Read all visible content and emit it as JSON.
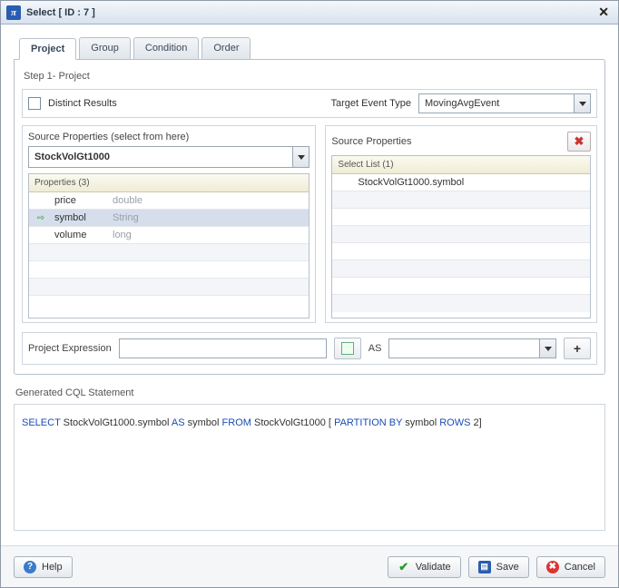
{
  "window": {
    "title": "Select [ ID : 7 ]"
  },
  "tabs": [
    {
      "label": "Project"
    },
    {
      "label": "Group"
    },
    {
      "label": "Condition"
    },
    {
      "label": "Order"
    }
  ],
  "step": "Step 1- Project",
  "distinct": {
    "label": "Distinct Results"
  },
  "target": {
    "label": "Target Event Type",
    "value": "MovingAvgEvent"
  },
  "sourceLeft": {
    "title": "Source Properties (select from here)",
    "selected": "StockVolGt1000",
    "gridTitle": "Properties (3)",
    "rows": [
      {
        "name": "price",
        "type": "double",
        "active": false
      },
      {
        "name": "symbol",
        "type": "String",
        "active": true
      },
      {
        "name": "volume",
        "type": "long",
        "active": false
      }
    ]
  },
  "sourceRight": {
    "title": "Source Properties",
    "gridTitle": "Select List (1)",
    "rows": [
      {
        "text": "StockVolGt1000.symbol"
      }
    ]
  },
  "projExpr": {
    "label": "Project Expression",
    "value": "",
    "asLabel": "AS",
    "asValue": ""
  },
  "generated": {
    "label": "Generated CQL Statement",
    "sql_parts": {
      "select": "SELECT",
      "col": " StockVolGt1000.symbol ",
      "as": "AS",
      "alias": " symbol ",
      "from": "FROM",
      "tbl": " StockVolGt1000  [ ",
      "pby": "PARTITION BY",
      "pcol": " symbol  ",
      "rows": "ROWS",
      "rnum": " 2]"
    }
  },
  "buttons": {
    "help": "Help",
    "validate": "Validate",
    "save": "Save",
    "cancel": "Cancel"
  }
}
